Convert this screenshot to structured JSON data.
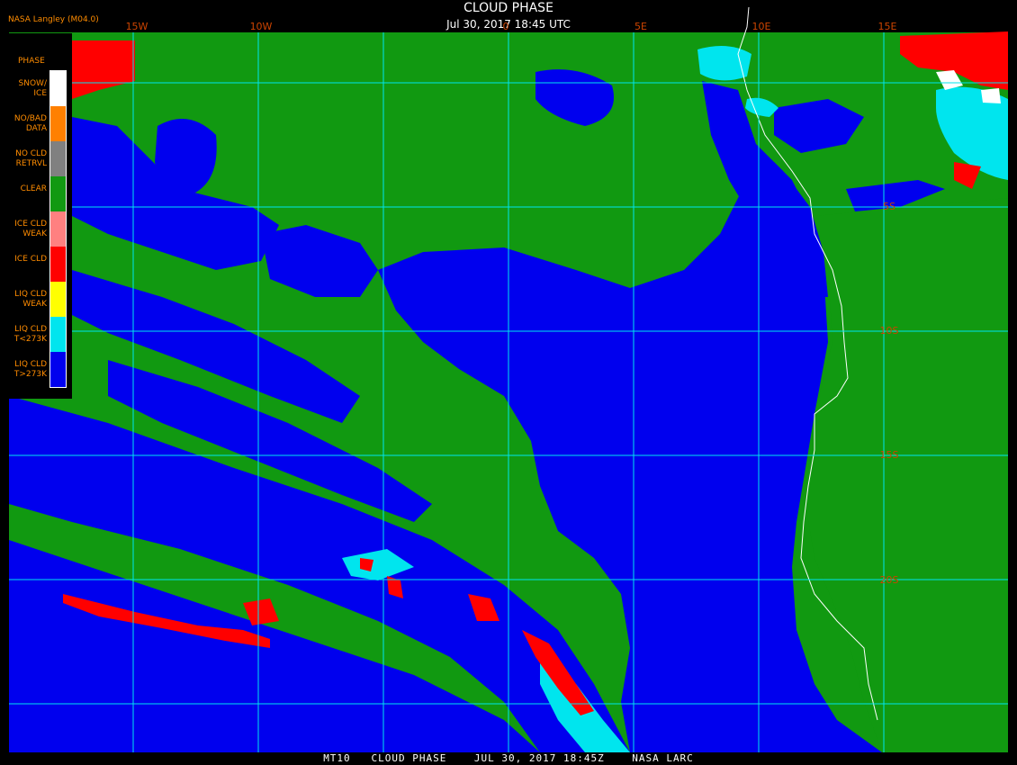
{
  "header": {
    "title": "CLOUD PHASE",
    "subtitle": "Jul 30, 2017 18:45 UTC",
    "org": "NASA Langley (M04.0)"
  },
  "footer": {
    "text": "MT10   CLOUD PHASE    JUL 30, 2017 18:45Z    NASA LARC"
  },
  "legend": {
    "header": "PHASE",
    "items": [
      {
        "label": "SNOW/\nICE",
        "color": "#ffffff"
      },
      {
        "label": "NO/BAD\nDATA",
        "color": "#ff8000"
      },
      {
        "label": "NO CLD\nRETRVL",
        "color": "#808080"
      },
      {
        "label": "CLEAR",
        "color": "#119911"
      },
      {
        "label": "ICE CLD\nWEAK",
        "color": "#ff8080"
      },
      {
        "label": "ICE CLD",
        "color": "#ff0000"
      },
      {
        "label": "LIQ CLD\nWEAK",
        "color": "#ffff00"
      },
      {
        "label": "LIQ CLD\nT<273K",
        "color": "#00e5ee"
      },
      {
        "label": "LIQ CLD\nT>273K",
        "color": "#0000ee"
      }
    ]
  },
  "map": {
    "lon_labels": [
      "15W",
      "10W",
      "0",
      "5E",
      "10E",
      "15E"
    ],
    "lat_labels": [
      "5S",
      "10S",
      "15S",
      "20S"
    ],
    "colors": {
      "clear": "#119911",
      "liq_warm": "#0000ee",
      "liq_cold": "#00e5ee",
      "ice": "#ff0000",
      "snow": "#ffffff",
      "grid": "#00e5ee",
      "coast": "#ffffff",
      "grid_label": "#cc4400"
    }
  }
}
